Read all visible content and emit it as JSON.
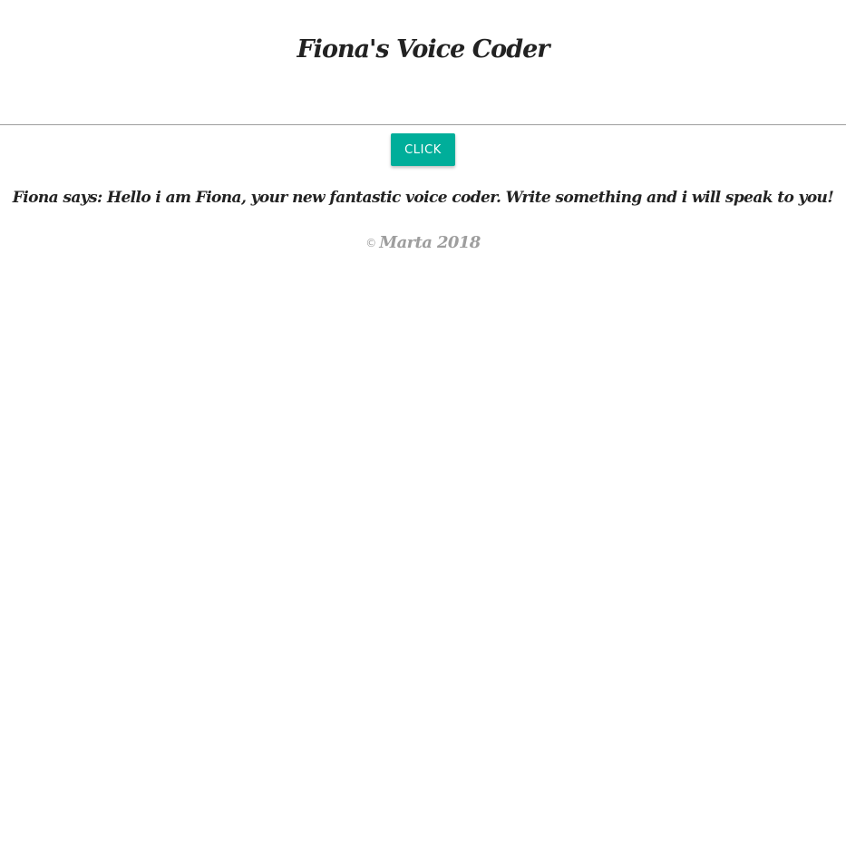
{
  "header": {
    "title": "Fiona's Voice Coder"
  },
  "action": {
    "button_label": "CLICK"
  },
  "message": {
    "text": "Fiona says: Hello i am Fiona, your new fantastic voice coder. Write something and i will speak to you!"
  },
  "footer": {
    "copyright_symbol": "©",
    "text": "Marta 2018"
  },
  "colors": {
    "accent": "#00ae9a",
    "text": "#222222",
    "muted": "#9e9e9e",
    "divider": "#9e9e9e",
    "background": "#ffffff"
  }
}
